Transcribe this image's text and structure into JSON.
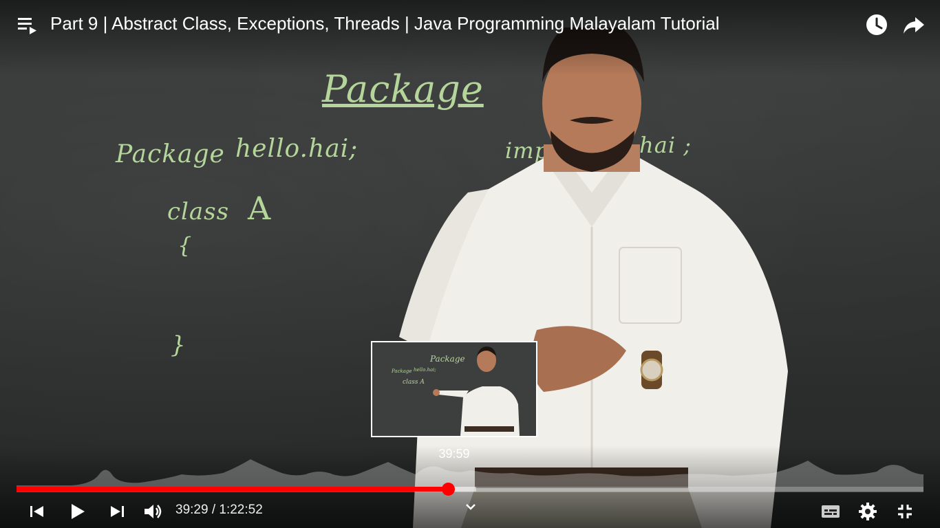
{
  "video": {
    "title": "Part 9 | Abstract Class, Exceptions, Threads | Java Programming Malayalam Tutorial",
    "board": {
      "heading": "Package",
      "line1_keyword": "Package",
      "line1_name": "hello.hai;",
      "line2_keyword": "class",
      "line2_name": "A",
      "open_brace": "{",
      "close_brace": "}",
      "right_text_a": "imp",
      "right_text_b": ".hai ;"
    },
    "preview": {
      "time": "39:59",
      "board": {
        "heading": "Package",
        "line1_keyword": "Package",
        "line1_name": "hello.hai;",
        "line2": "class A"
      }
    }
  },
  "player": {
    "current_time": "39:29",
    "separator": " / ",
    "duration": "1:22:52",
    "progress_played": 0.476,
    "progress_buffered": 0.507,
    "accent_color": "#ff0000"
  },
  "icons": {
    "playlist": "playlist-icon",
    "watch_later": "clock-icon",
    "share": "share-arrow-icon",
    "previous": "previous-icon",
    "play": "play-icon",
    "next": "next-icon",
    "volume": "volume-icon",
    "chevron": "chevron-down-icon",
    "subtitles": "subtitles-icon",
    "settings": "gear-icon",
    "exit_fullscreen": "exit-fullscreen-icon"
  }
}
